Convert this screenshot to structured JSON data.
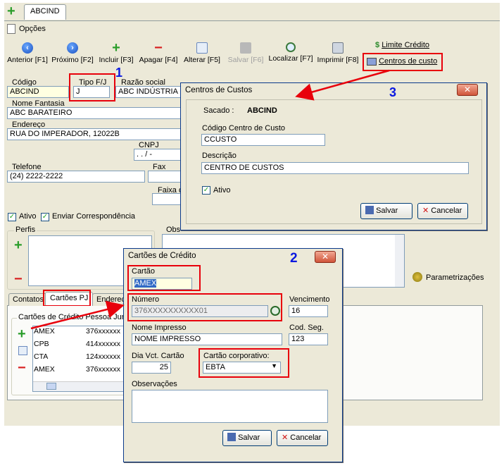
{
  "tabs": {
    "add_symbol": "+",
    "main_tab": "ABCIND"
  },
  "menu": {
    "options": "Opções"
  },
  "toolbar": {
    "anterior": "Anterior [F1]",
    "proximo": "Próximo [F2]",
    "incluir": "Incluir [F3]",
    "apagar": "Apagar [F4]",
    "alterar": "Alterar [F5]",
    "salvar": "Salvar [F6]",
    "localizar": "Localizar [F7]",
    "imprimir": "Imprimir [F8]",
    "limite_credito": "Limite Crédito",
    "centros_custo": "Centros de custo"
  },
  "form": {
    "codigo_label": "Código",
    "codigo_value": "ABCIND",
    "tipo_label": "Tipo F/J",
    "tipo_value": "J",
    "razao_label": "Razão social",
    "razao_value": "ABC INDÚSTRIA E",
    "nome_fantasia_label": "Nome Fantasia",
    "nome_fantasia_value": "ABC BARATEIRO",
    "endereco_label": "Endereço",
    "endereco_value": "RUA DO IMPERADOR, 12022B",
    "cnpj_label": "CNPJ",
    "cnpj_value": ". . / -",
    "telefone_label": "Telefone",
    "telefone_value": "(24) 2222-2222",
    "fax_label": "Fax",
    "faixa_label": "Faixa d",
    "ativo_label": "Ativo",
    "enviar_label": "Enviar Correspondência",
    "perfis_label": "Perfis",
    "obs_label": "Obs",
    "parametrizacoes": "Parametrizações"
  },
  "lower_tabs": {
    "contatos": "Contatos",
    "cartoes_pj": "Cartões PJ",
    "endereco": "Endereço"
  },
  "cards_panel": {
    "title": "Cartões de Crédito Pessoa Jurídi",
    "rows": [
      {
        "name": "AMEX",
        "number": "376xxxxxx"
      },
      {
        "name": "CPB",
        "number": "414xxxxxx"
      },
      {
        "name": "CTA",
        "number": "124xxxxxx"
      },
      {
        "name": "AMEX",
        "number": "376xxxxxx"
      }
    ]
  },
  "annotations": {
    "one": "1",
    "two": "2",
    "three": "3"
  },
  "centros_dialog": {
    "title": "Centros de Custos",
    "sacado_label": "Sacado :",
    "sacado_value": "ABCIND",
    "codigo_label": "Código Centro de Custo",
    "codigo_value": "CCUSTO",
    "descricao_label": "Descrição",
    "descricao_value": "CENTRO DE CUSTOS",
    "ativo_label": "Ativo",
    "salvar": "Salvar",
    "cancelar": "Cancelar"
  },
  "cartoes_dialog": {
    "title": "Cartões de Crédito",
    "cartao_label": "Cartão",
    "cartao_value": "AMEX",
    "numero_label": "Número",
    "numero_value": "376XXXXXXXXXX01",
    "vencimento_label": "Vencimento",
    "vencimento_value": "16",
    "nome_label": "Nome Impresso",
    "nome_value": "NOME IMPRESSO",
    "codseg_label": "Cod. Seg.",
    "codseg_value": "123",
    "dia_label": "Dia Vct. Cartão",
    "dia_value": "25",
    "corp_label": "Cartão corporativo:",
    "corp_value": "EBTA",
    "obs_label": "Observações",
    "salvar": "Salvar",
    "cancelar": "Cancelar"
  },
  "colors": {
    "annotation_red": "#e8000b",
    "annotation_blue": "#0a18e0",
    "window_bg": "#ece9d8"
  }
}
